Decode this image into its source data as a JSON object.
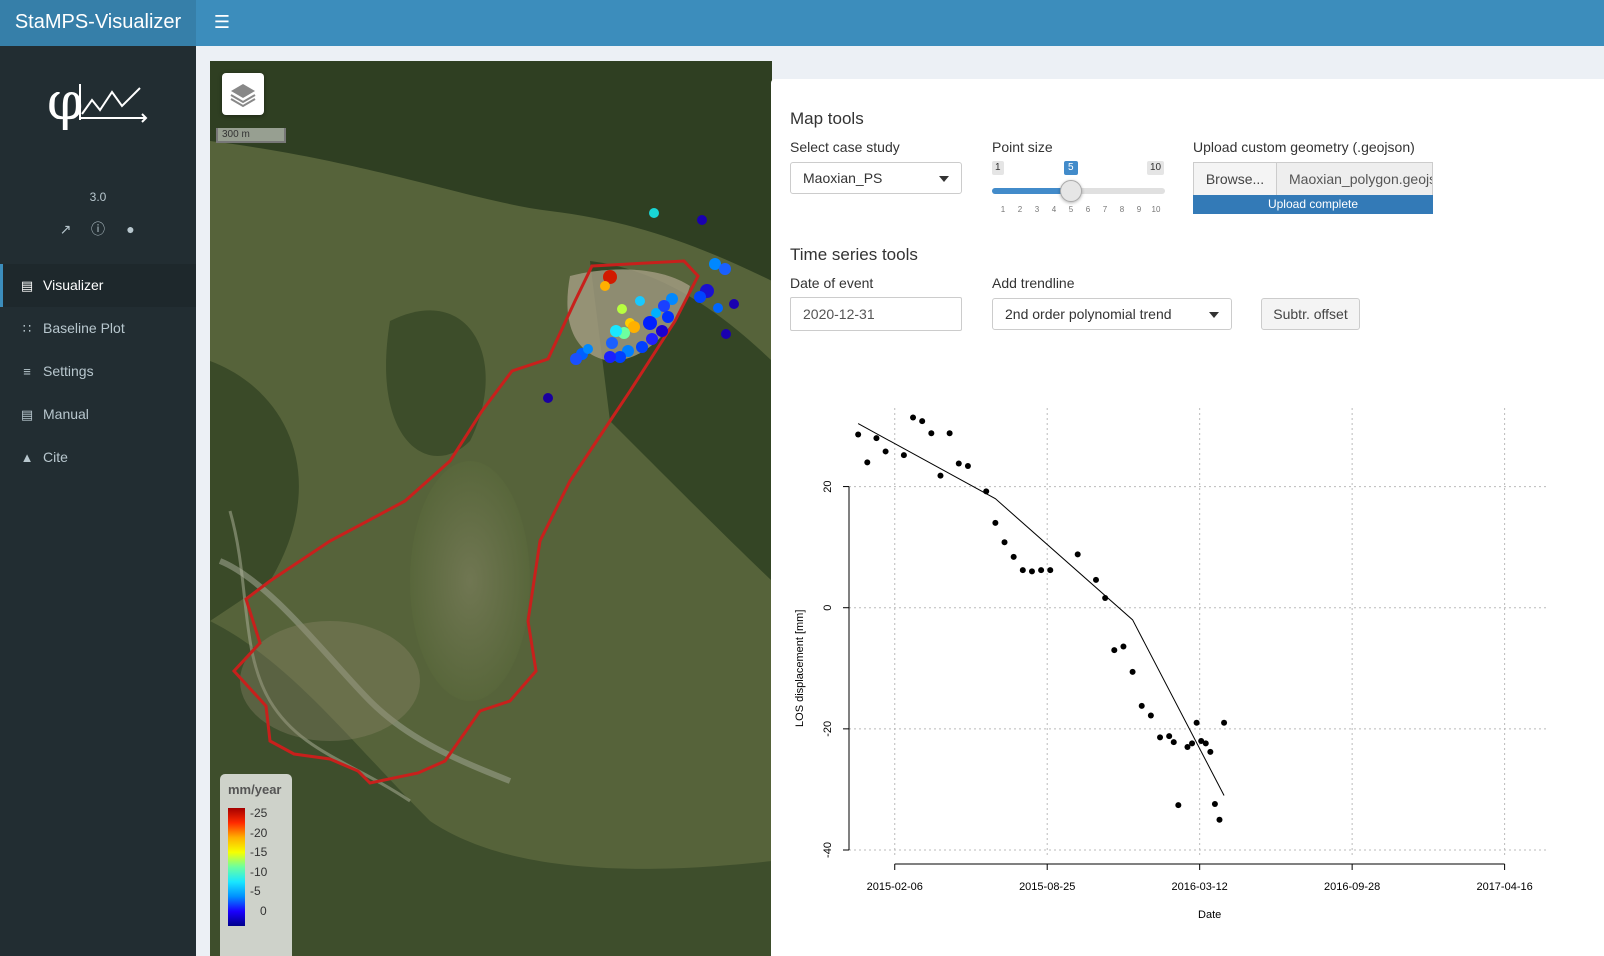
{
  "app": {
    "title": "StaMPS-Visualizer",
    "version": "3.0"
  },
  "sidebar": {
    "social_icons": [
      "external-link-icon",
      "info-circle-icon",
      "github-icon"
    ],
    "items": [
      {
        "label": "Visualizer",
        "icon": "map-icon",
        "active": true
      },
      {
        "label": "Baseline Plot",
        "icon": "network-icon",
        "active": false
      },
      {
        "label": "Settings",
        "icon": "sliders-icon",
        "active": false
      },
      {
        "label": "Manual",
        "icon": "book-icon",
        "active": false
      },
      {
        "label": "Cite",
        "icon": "graduation-cap-icon",
        "active": false
      }
    ]
  },
  "map": {
    "scale_label": "300 m",
    "legend": {
      "title": "mm/year",
      "labels": [
        "-25",
        "-20",
        "-15",
        "-10",
        "-5",
        "0"
      ],
      "gradient": [
        "#a50000",
        "#ff2a00",
        "#ffb000",
        "#f6ff00",
        "#6cffa0",
        "#19e7ff",
        "#0090ff",
        "#1a00ff",
        "#00008b"
      ]
    },
    "polygon_color": "#c8201c"
  },
  "map_tools": {
    "title": "Map tools",
    "case_study": {
      "label": "Select case study",
      "value": "Maoxian_PS"
    },
    "point_size": {
      "label": "Point size",
      "min": 1,
      "max": 10,
      "value": 5,
      "ticks": [
        "1",
        "2",
        "3",
        "4",
        "5",
        "6",
        "7",
        "8",
        "9",
        "10"
      ]
    },
    "upload": {
      "label": "Upload custom geometry (.geojson)",
      "browse_label": "Browse...",
      "file_name": "Maoxian_polygon.geojson",
      "status": "Upload complete"
    }
  },
  "ts_tools": {
    "title": "Time series tools",
    "date_of_event": {
      "label": "Date of event",
      "value": "2020-12-31"
    },
    "trendline": {
      "label": "Add trendline",
      "value": "2nd order polynomial trend"
    },
    "offset_button": "Subtr. offset"
  },
  "chart_data": {
    "type": "scatter",
    "xlabel": "Date",
    "ylabel": "LOS displacement [mm]",
    "x_ticks": [
      "2015-02-06",
      "2015-08-25",
      "2016-03-12",
      "2016-09-28",
      "2017-04-16"
    ],
    "y_ticks": [
      "20",
      "0",
      "-20",
      "-40"
    ],
    "xlim": [
      "2014-12-08",
      "2017-05-18"
    ],
    "ylim": [
      -40,
      30
    ],
    "grid": true,
    "trendline": "2nd order polynomial",
    "points": [
      [
        "2014-12-20",
        28.6
      ],
      [
        "2015-01-01",
        24.0
      ],
      [
        "2015-01-13",
        28.0
      ],
      [
        "2015-01-25",
        25.8
      ],
      [
        "2015-02-18",
        25.2
      ],
      [
        "2015-03-02",
        31.4
      ],
      [
        "2015-03-14",
        30.8
      ],
      [
        "2015-03-26",
        28.8
      ],
      [
        "2015-04-07",
        21.8
      ],
      [
        "2015-04-19",
        28.8
      ],
      [
        "2015-05-01",
        23.8
      ],
      [
        "2015-05-13",
        23.4
      ],
      [
        "2015-06-06",
        19.2
      ],
      [
        "2015-06-18",
        14.0
      ],
      [
        "2015-06-30",
        10.8
      ],
      [
        "2015-07-12",
        8.4
      ],
      [
        "2015-07-24",
        6.2
      ],
      [
        "2015-08-05",
        6.0
      ],
      [
        "2015-08-17",
        6.2
      ],
      [
        "2015-08-29",
        6.2
      ],
      [
        "2015-10-04",
        8.8
      ],
      [
        "2015-10-28",
        4.6
      ],
      [
        "2015-11-09",
        1.6
      ],
      [
        "2015-11-21",
        -7.0
      ],
      [
        "2015-12-03",
        -6.4
      ],
      [
        "2015-12-15",
        -10.6
      ],
      [
        "2015-12-27",
        -16.2
      ],
      [
        "2016-01-08",
        -17.8
      ],
      [
        "2016-01-20",
        -21.4
      ],
      [
        "2016-02-01",
        -21.2
      ],
      [
        "2016-02-07",
        -22.2
      ],
      [
        "2016-02-13",
        -32.6
      ],
      [
        "2016-02-25",
        -23.0
      ],
      [
        "2016-03-02",
        -22.4
      ],
      [
        "2016-03-08",
        -19.0
      ],
      [
        "2016-03-14",
        -22.0
      ],
      [
        "2016-03-20",
        -22.4
      ],
      [
        "2016-03-26",
        -23.8
      ],
      [
        "2016-04-01",
        -32.4
      ],
      [
        "2016-04-07",
        -35.0
      ],
      [
        "2016-04-13",
        -19.0
      ]
    ],
    "trend": [
      [
        "2014-12-20",
        30.4
      ],
      [
        "2015-06-18",
        18.0
      ],
      [
        "2015-12-15",
        -2.0
      ],
      [
        "2016-04-13",
        -31.0
      ]
    ]
  }
}
